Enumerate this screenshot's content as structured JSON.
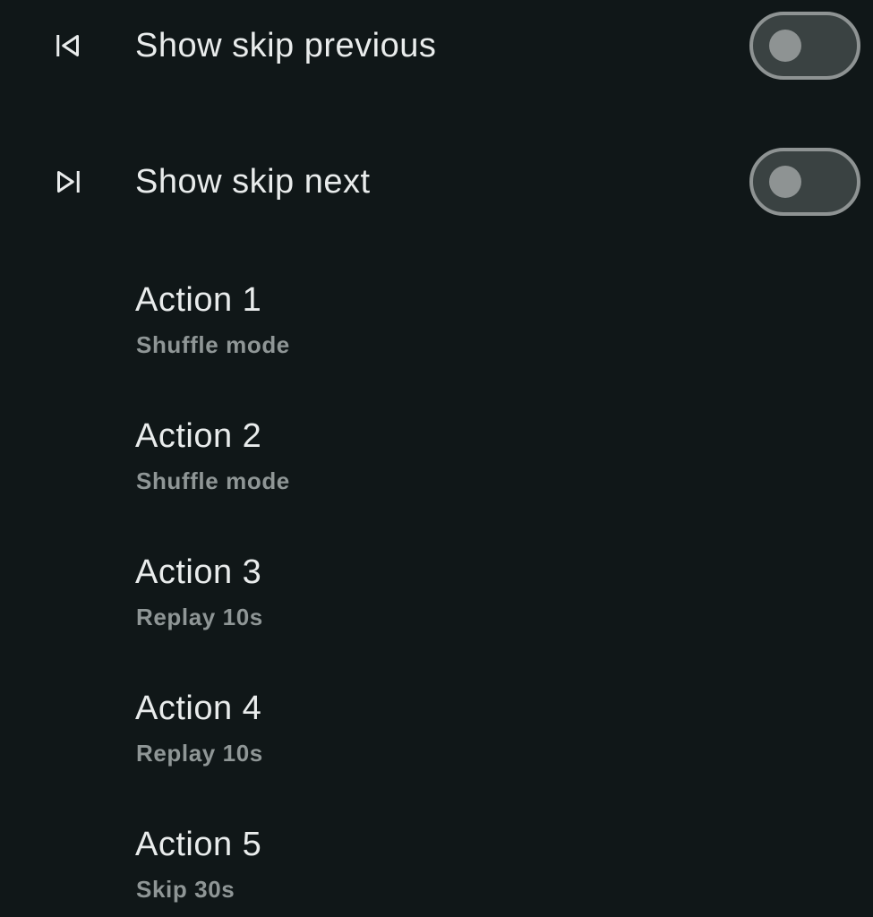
{
  "settings": {
    "skip_previous": {
      "label": "Show skip previous",
      "icon": "skip-previous-icon",
      "enabled": false
    },
    "skip_next": {
      "label": "Show skip next",
      "icon": "skip-next-icon",
      "enabled": false
    },
    "actions": [
      {
        "title": "Action 1",
        "value": "Shuffle mode"
      },
      {
        "title": "Action 2",
        "value": "Shuffle mode"
      },
      {
        "title": "Action 3",
        "value": "Replay 10s"
      },
      {
        "title": "Action 4",
        "value": "Replay 10s"
      },
      {
        "title": "Action 5",
        "value": "Skip 30s"
      }
    ]
  },
  "colors": {
    "background": "#101718",
    "primary_text": "#e9ecec",
    "secondary_text": "#8f9696",
    "switch_off_track": "#3a4242",
    "switch_off_outline": "#8e9393"
  }
}
